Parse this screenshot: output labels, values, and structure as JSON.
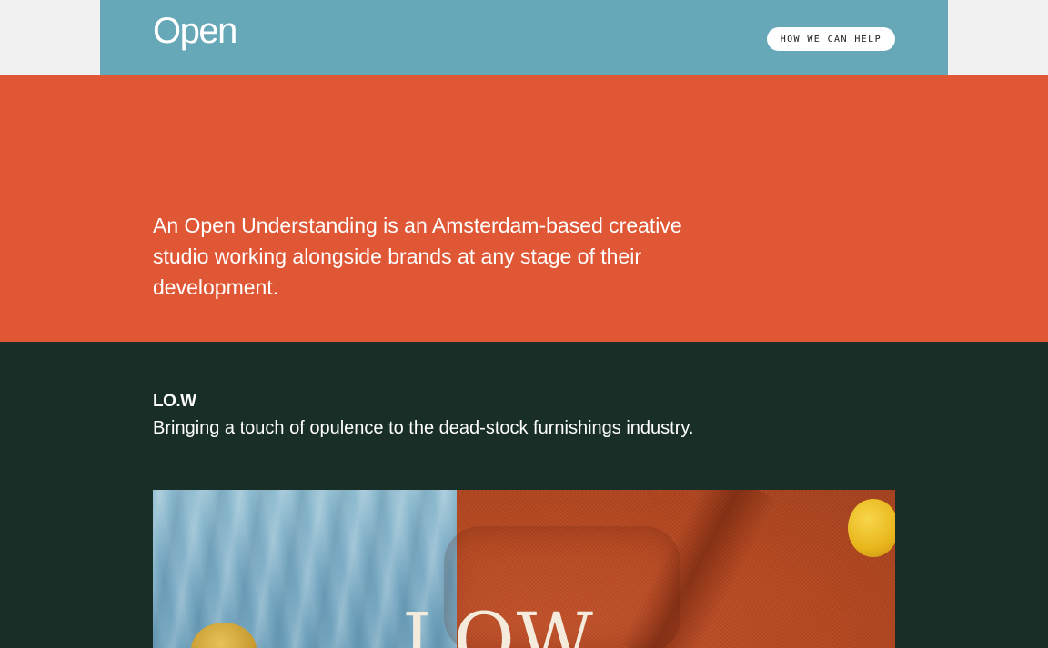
{
  "header": {
    "logo": "Open",
    "help_button": "HOW WE CAN HELP"
  },
  "intro": {
    "text": "An Open Understanding is an Amsterdam-based creative studio working alongside brands at any stage of their development."
  },
  "project": {
    "title": "LO.W",
    "description": "Bringing a touch of opulence to the dead-stock furnishings industry.",
    "image_wordmark": "LOW"
  },
  "colors": {
    "header_bg": "#66a8b8",
    "intro_bg": "#e05735",
    "project_bg": "#182e26",
    "page_bg": "#f2f1f1"
  }
}
